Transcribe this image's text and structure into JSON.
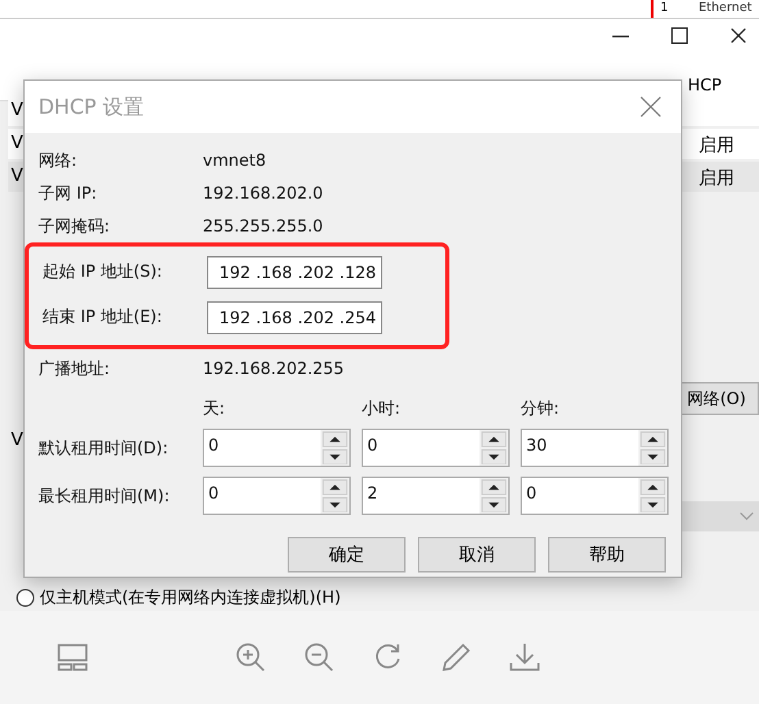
{
  "background_window": {
    "top_strip": [
      "1",
      "Ethernet"
    ],
    "table": {
      "header": "HCP",
      "rows": [
        {
          "column_1": "V",
          "selected": false
        },
        {
          "column_1": "V",
          "dhcp": "启用",
          "selected": false
        },
        {
          "column_1": "V",
          "dhcp": "启用",
          "selected": true
        }
      ]
    },
    "network_button": "网络(O)",
    "left_letter": "V",
    "radios": [
      {
        "label": "仅主机模式(在专用网络内连接虚拟机)(H)",
        "selected": false
      }
    ]
  },
  "dialog": {
    "title": "DHCP 设置",
    "info": [
      {
        "label": "网络:",
        "value": "vmnet8"
      },
      {
        "label": "子网 IP:",
        "value": "192.168.202.0"
      },
      {
        "label": "子网掩码:",
        "value": "255.255.255.0"
      }
    ],
    "ip_fields": [
      {
        "label": "起始 IP 地址(S):",
        "value": "192 .168 .202 .128"
      },
      {
        "label": "结束 IP 地址(E):",
        "value": "192 .168 .202 .254"
      }
    ],
    "broadcast": {
      "label": "广播地址:",
      "value": "192.168.202.255"
    },
    "lease": {
      "units": [
        "天:",
        "小时:",
        "分钟:"
      ],
      "rows": [
        {
          "label": "默认租用时间(D):",
          "values": [
            "0",
            "0",
            "30"
          ]
        },
        {
          "label": "最长租用时间(M):",
          "values": [
            "0",
            "2",
            "0"
          ]
        }
      ]
    },
    "buttons": [
      "确定",
      "取消",
      "帮助"
    ]
  }
}
